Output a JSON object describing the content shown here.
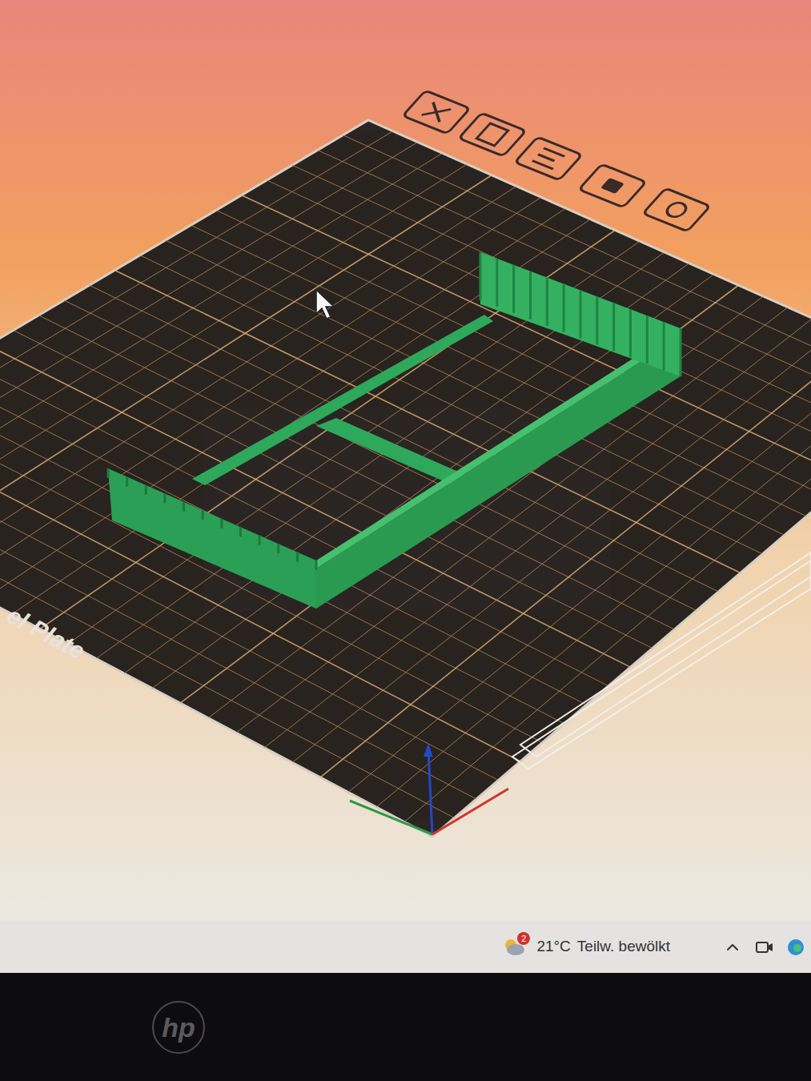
{
  "plate": {
    "label": "el Plate"
  },
  "taskbar": {
    "weather": {
      "temperature": "21°C",
      "condition": "Teilw. bewölkt",
      "badge": "2"
    }
  },
  "monitor": {
    "logo": "hp"
  }
}
